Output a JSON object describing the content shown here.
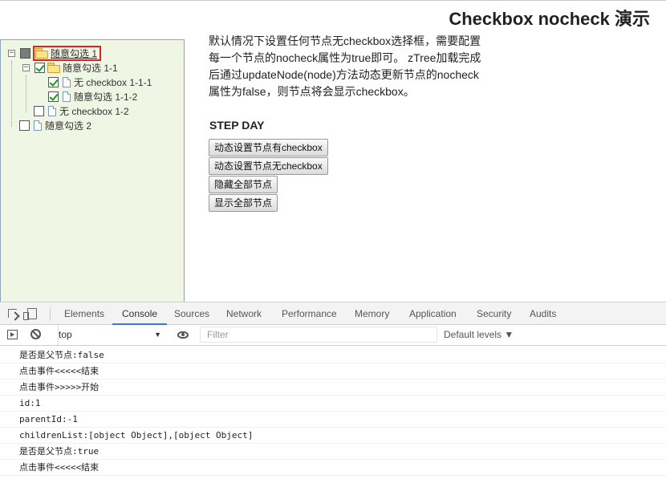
{
  "page": {
    "title": "Checkbox nocheck 演示"
  },
  "tree": {
    "root1": {
      "label": "随意勾选 1"
    },
    "child11": {
      "label": "随意勾选 1-1"
    },
    "leaf111": {
      "label": "无 checkbox 1-1-1"
    },
    "leaf112": {
      "label": "随意勾选 1-1-2"
    },
    "leaf12": {
      "label": "无 checkbox 1-2"
    },
    "root2": {
      "label": "随意勾选 2"
    }
  },
  "description": {
    "text": "默认情况下设置任何节点无checkbox选择框，需要配置每一个节点的nocheck属性为true即可。 zTree加载完成后通过updateNode(node)方法动态更新节点的nocheck属性为false，则节点将会显示checkbox。",
    "step_label": "STEP DAY"
  },
  "buttons": {
    "show_check": "动态设置节点有checkbox",
    "hide_check": "动态设置节点无checkbox",
    "hide_all": "隐藏全部节点",
    "show_all": "显示全部节点"
  },
  "devtools": {
    "tabs": [
      "Elements",
      "Console",
      "Sources",
      "Network",
      "Performance",
      "Memory",
      "Application",
      "Security",
      "Audits"
    ],
    "active_tab": "Console",
    "context": "top",
    "filter_placeholder": "Filter",
    "levels": "Default levels ▼"
  },
  "console": {
    "lines": [
      "是否是父节点:false",
      "点击事件<<<<<结束",
      "点击事件>>>>>开始",
      "id:1",
      "parentId:-1",
      "childrenList:[object Object],[object Object]",
      "是否是父节点:true",
      "点击事件<<<<<结束"
    ]
  },
  "colors": {
    "tree_bg": "#f0f6e4",
    "selected_border": "#e02020",
    "active_tab_underline": "#3879d9"
  }
}
